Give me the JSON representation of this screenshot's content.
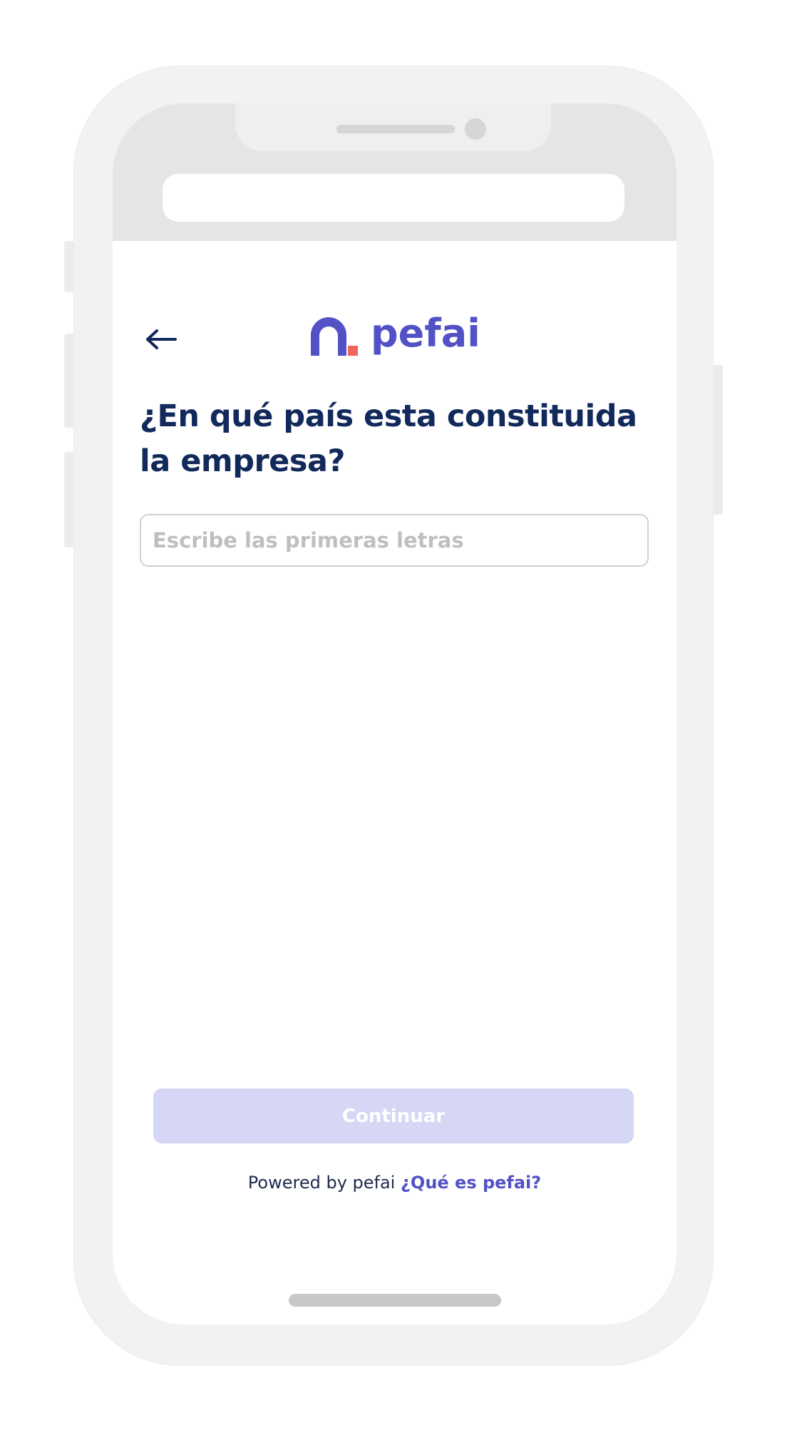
{
  "brand": {
    "name": "pefai",
    "primary_color": "#5252c6",
    "accent_color": "#f0645a",
    "title_color": "#12295b"
  },
  "header": {
    "back_icon": "arrow-left-icon"
  },
  "main": {
    "title": "¿En qué país esta constituida la empresa?",
    "country_input": {
      "value": "",
      "placeholder": "Escribe las primeras letras"
    },
    "continue_label": "Continuar",
    "continue_enabled": false
  },
  "footer": {
    "powered_by": "Powered by pefai",
    "link_label": "¿Qué es pefai?"
  }
}
